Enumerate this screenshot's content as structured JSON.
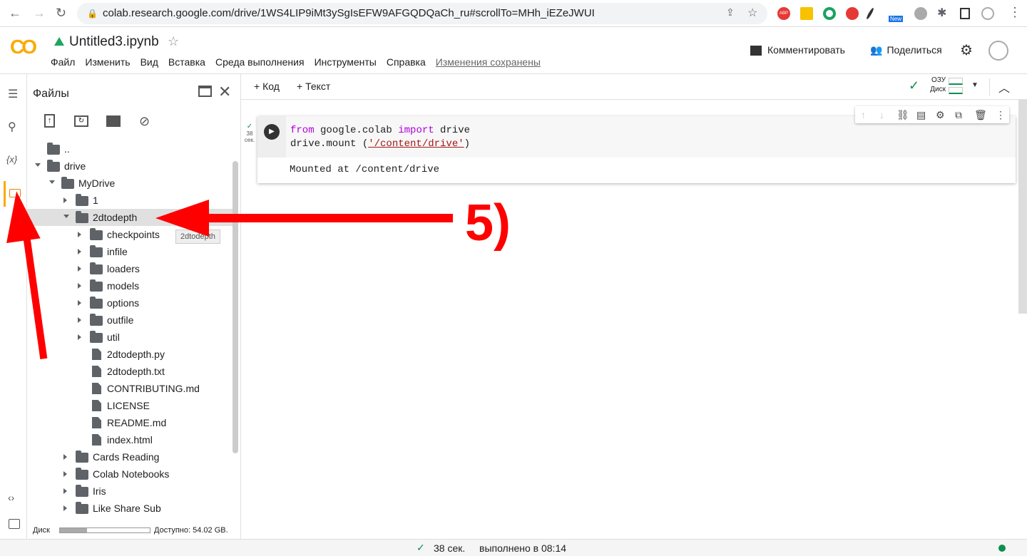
{
  "browser": {
    "url": "colab.research.google.com/drive/1WS4LIP9iMt3ySgIsEFW9AFGQDQaCh_ru#scrollTo=MHh_iEZeJWUI",
    "ext_new": "New",
    "ext_abp": "ABP"
  },
  "header": {
    "logo": "CO",
    "title": "Untitled3.ipynb",
    "menu": [
      "Файл",
      "Изменить",
      "Вид",
      "Вставка",
      "Среда выполнения",
      "Инструменты",
      "Справка"
    ],
    "saved": "Изменения сохранены",
    "comment": "Комментировать",
    "share": "Поделиться"
  },
  "toolbar": {
    "add_code": "+ Код",
    "add_text": "+ Текст",
    "ram": "ОЗУ",
    "disk": "Диск"
  },
  "files": {
    "title": "Файлы",
    "tooltip": "2dtodepth",
    "disk_label": "Диск",
    "disk_used_fraction": 0.3,
    "available": "Доступно: 54.02 GB.",
    "tree": [
      {
        "name": "..",
        "level": 0,
        "type": "up"
      },
      {
        "name": "drive",
        "level": 0,
        "type": "folder",
        "open": true
      },
      {
        "name": "MyDrive",
        "level": 1,
        "type": "folder",
        "open": true
      },
      {
        "name": "1",
        "level": 2,
        "type": "folder"
      },
      {
        "name": "2dtodepth",
        "level": 2,
        "type": "folder",
        "open": true,
        "selected": true
      },
      {
        "name": "checkpoints",
        "level": 3,
        "type": "folder"
      },
      {
        "name": "infile",
        "level": 3,
        "type": "folder"
      },
      {
        "name": "loaders",
        "level": 3,
        "type": "folder"
      },
      {
        "name": "models",
        "level": 3,
        "type": "folder"
      },
      {
        "name": "options",
        "level": 3,
        "type": "folder"
      },
      {
        "name": "outfile",
        "level": 3,
        "type": "folder"
      },
      {
        "name": "util",
        "level": 3,
        "type": "folder"
      },
      {
        "name": "2dtodepth.py",
        "level": 3,
        "type": "file"
      },
      {
        "name": "2dtodepth.txt",
        "level": 3,
        "type": "file"
      },
      {
        "name": "CONTRIBUTING.md",
        "level": 3,
        "type": "file"
      },
      {
        "name": "LICENSE",
        "level": 3,
        "type": "file"
      },
      {
        "name": "README.md",
        "level": 3,
        "type": "file"
      },
      {
        "name": "index.html",
        "level": 3,
        "type": "file"
      },
      {
        "name": "Cards Reading",
        "level": 2,
        "type": "folder"
      },
      {
        "name": "Colab Notebooks",
        "level": 2,
        "type": "folder"
      },
      {
        "name": "Iris",
        "level": 2,
        "type": "folder"
      },
      {
        "name": "Like Share Sub",
        "level": 2,
        "type": "folder"
      }
    ]
  },
  "cell": {
    "exec_time": "38",
    "exec_unit": "сек.",
    "line1": {
      "kw1": "from",
      "mod": " google.colab ",
      "kw2": "import",
      "name": " drive"
    },
    "line2": {
      "pre": "drive.mount (",
      "str": "'/content/drive'",
      "post": ")"
    },
    "output": "Mounted at /content/drive"
  },
  "annotation": {
    "label": "5)"
  },
  "status": {
    "time": "38 сек.",
    "done": "выполнено в 08:14"
  },
  "colors": {
    "accent": "#f9ab00",
    "arrow": "#ff0000",
    "keyword": "#af00db",
    "string": "#a31515"
  }
}
